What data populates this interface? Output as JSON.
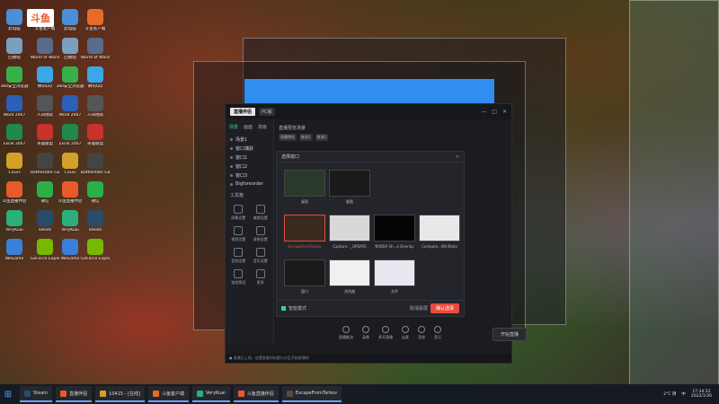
{
  "desktop": {
    "icons": [
      {
        "label": "此电脑",
        "color": "#4a8fd8"
      },
      {
        "label": "回收站",
        "color": "#7aa0c0"
      },
      {
        "label": "360安全浏览器",
        "color": "#38b04a"
      },
      {
        "label": "Word 2007",
        "color": "#2b5fb8"
      },
      {
        "label": "Excel 2007",
        "color": "#1f8a4a"
      },
      {
        "label": "CSGO",
        "color": "#d4a02a"
      },
      {
        "label": "斗鱼直播伴侣",
        "color": "#e85a2a"
      },
      {
        "label": "VeryKuai",
        "color": "#2ab07a"
      },
      {
        "label": "WeGame",
        "color": "#3a7fd8"
      },
      {
        "label": "斗鱼客户端",
        "color": "#e86a2a"
      },
      {
        "label": "World of Warships",
        "color": "#5a6a8a"
      },
      {
        "label": "腾讯QQ",
        "color": "#3aa8e8"
      },
      {
        "label": "人间地狱",
        "color": "#555555"
      },
      {
        "label": "英雄联盟",
        "color": "#c8322a"
      },
      {
        "label": "Battlestate Games",
        "color": "#444444"
      },
      {
        "label": "微信",
        "color": "#2ab04a"
      },
      {
        "label": "Steam",
        "color": "#2a4a6a"
      },
      {
        "label": "GeForce Experience",
        "color": "#76b900"
      }
    ],
    "corner_logo": "斗鱼"
  },
  "app": {
    "logo": "直播伴侣",
    "version_tag": "PC版",
    "left_tabs": [
      "场景",
      "画面",
      "高级"
    ],
    "scenes": [
      "场景1",
      "窗口捕获",
      "窗口1",
      "窗口2",
      "窗口3",
      "Bigforeorder"
    ],
    "tools_label": "工具箱",
    "tools": [
      "屏幕设置",
      "美颜设置",
      "视频设置",
      "录制设置",
      "音频设置",
      "音乐设置",
      "游戏预设",
      "更多"
    ],
    "preview_title": "直播预览场景",
    "preview_tags": [
      "直播预览",
      "推流1",
      "推流2"
    ],
    "dialog": {
      "title": "选择窗口",
      "tiles": [
        {
          "label": "桌面",
          "bg": "#2a3a2a"
        },
        {
          "label": "截图",
          "bg": "#1a1a1a"
        },
        {
          "label": "EscapeFromTarkov",
          "bg": "#3a2a20"
        },
        {
          "label": "Capture..._UPDATE",
          "bg": "#d8d8d8"
        },
        {
          "label": "NVIDIA Sh...e Overlay",
          "bg": "#050505"
        },
        {
          "label": "Compute...WinRatio",
          "bg": "#e8e8e8"
        },
        {
          "label": "窗口",
          "bg": "#1a1a1a"
        },
        {
          "label": "浏览器",
          "bg": "#f0f0f0"
        },
        {
          "label": "文件",
          "bg": "#e8e8f0"
        }
      ],
      "checkbox_label": "智能模式",
      "cancel_label": "取消投屏",
      "ok_label": "确认选择"
    },
    "bottom_tools": [
      "直播推流",
      "录像",
      "多开直播",
      "连麦",
      "音效",
      "音乐"
    ],
    "start_label": "开始直播",
    "status": "● 直播已上线，设置直播间标题与分区开始直播吧"
  },
  "taskbar": {
    "items": [
      {
        "label": "Steam",
        "color": "#2a4a6a"
      },
      {
        "label": "直播伴侣",
        "color": "#e85a2a"
      },
      {
        "label": "10415 - [在线]",
        "color": "#d4a02a"
      },
      {
        "label": "斗鱼客户端",
        "color": "#e86a2a"
      },
      {
        "label": "VeryKuai",
        "color": "#2ab07a"
      },
      {
        "label": "斗鱼直播伴侣",
        "color": "#e85a2a"
      },
      {
        "label": "EscapeFromTarkov",
        "color": "#5a4a3a"
      }
    ],
    "weather": "2°C 阴",
    "ime": "中",
    "time": "17:34:22",
    "date": "2022/1/30"
  }
}
